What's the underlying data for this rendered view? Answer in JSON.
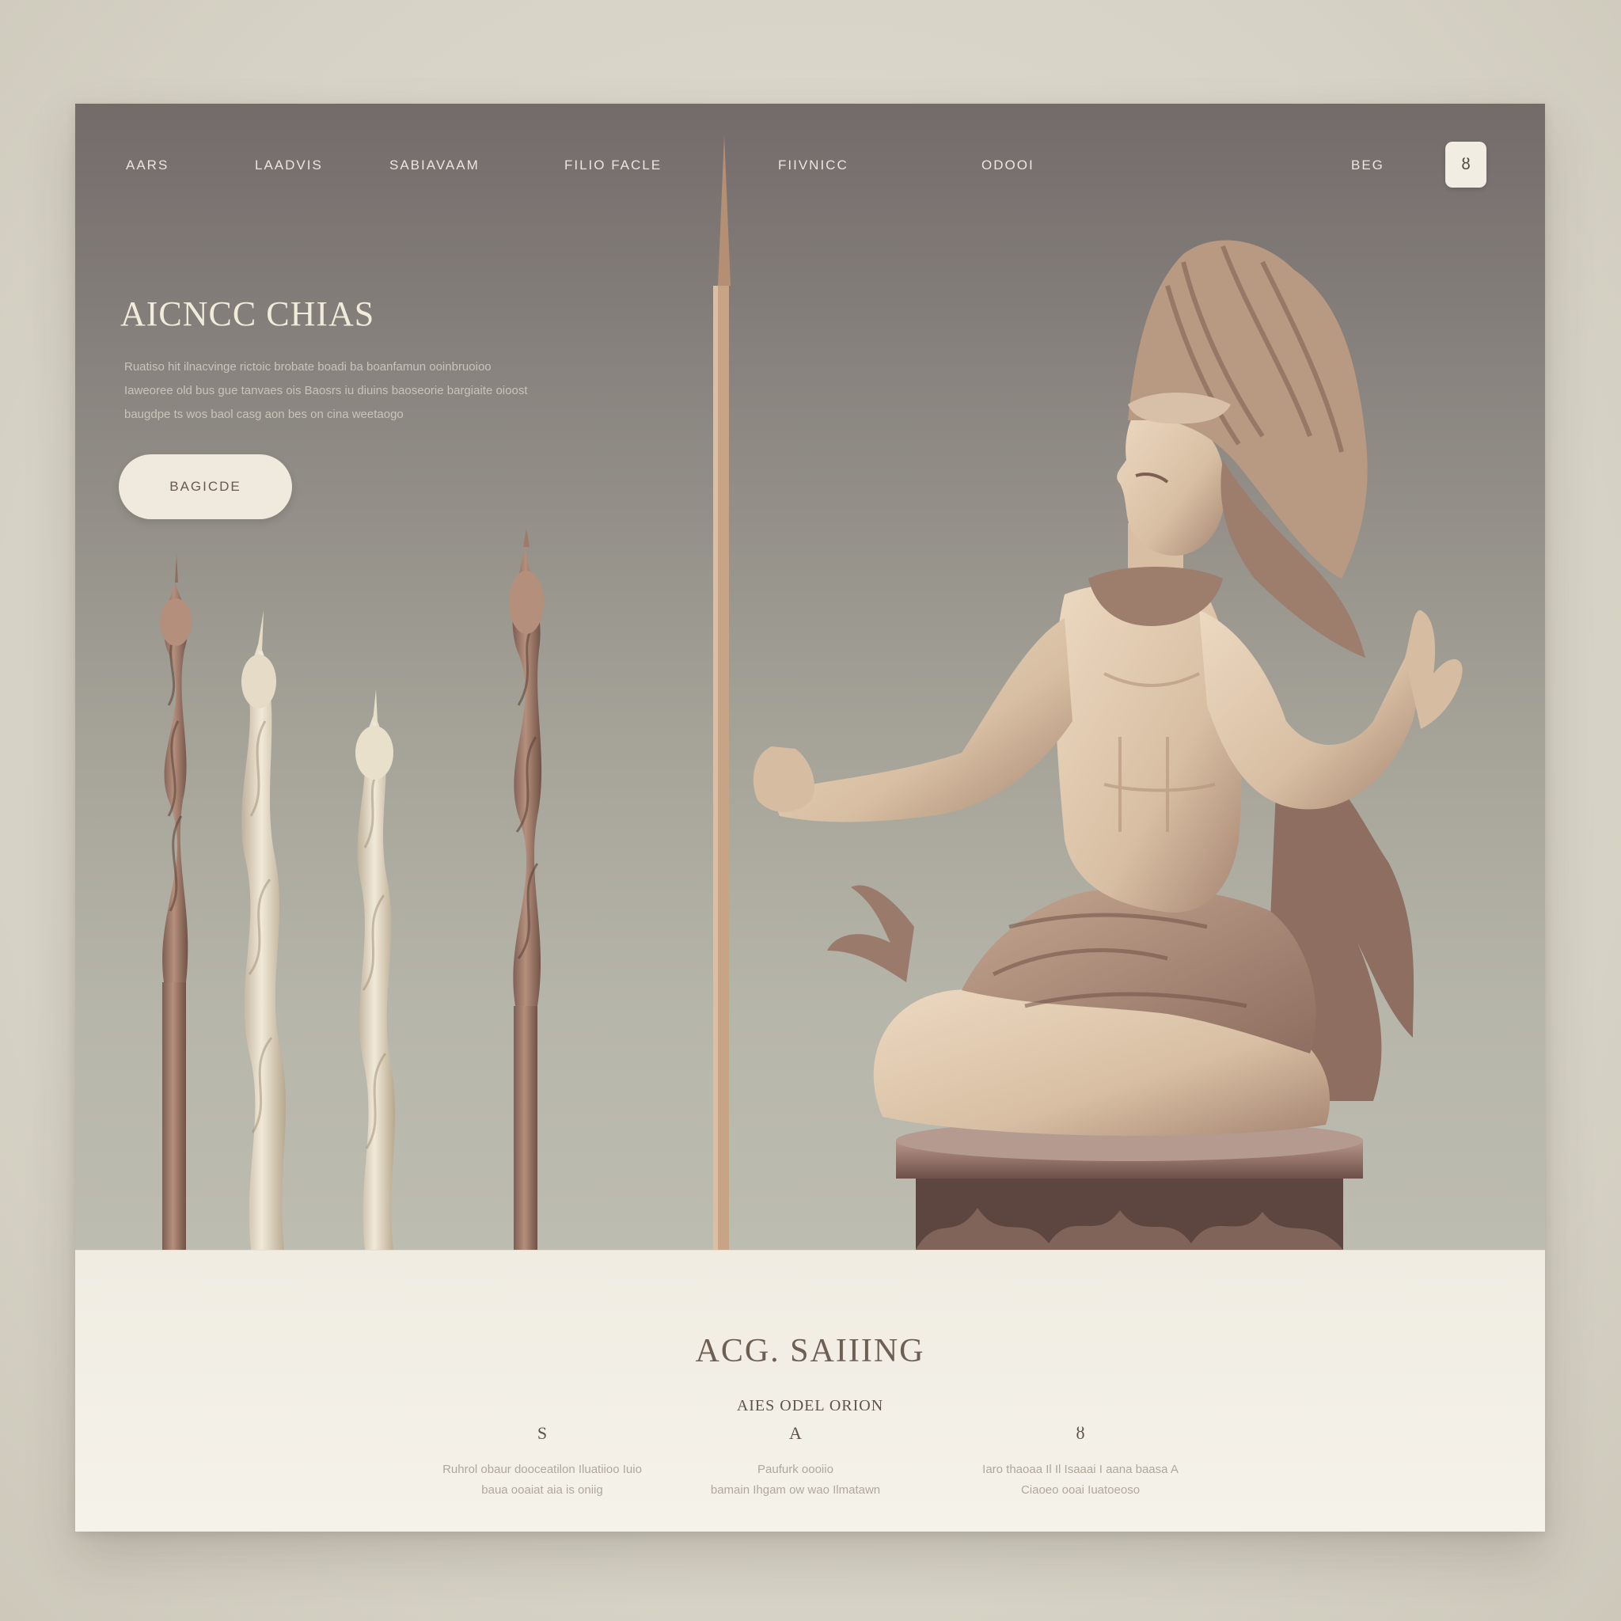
{
  "nav": {
    "items": [
      "AARS",
      "LAADVIS",
      "SABIAVAAM",
      "FILIO FACLE",
      "FIIVNICC",
      "ODOOI",
      "BEG"
    ],
    "action_icon": "user-icon",
    "action_glyph": "ȣ"
  },
  "hero": {
    "title": "AICNCC CHIAS",
    "description_lines": [
      "Ruatiso hit ilnacvinge rictoic brobate boadi ba boanfamun ooinbruoioo",
      "Iaweoree old bus gue tanvaes ois Baosrs iu diuins baoseorie bargiaite oioost",
      "baugdpe ts wos baol casg aon bes on cina weetaogo"
    ],
    "cta_label": "BAGICDE"
  },
  "section": {
    "title": "ACG. SAIIING",
    "subtitle": "AIES ODEL ORION",
    "features": [
      {
        "icon": "S",
        "lines": [
          "Ruhrol obaur dooceatilon Iluatiioo Iuio",
          "baua ooaiat aia is oniig"
        ]
      },
      {
        "icon": "A",
        "lines": [
          "Paufurk oooiio",
          "bamain Ihgam ow wao Ilmatawn"
        ]
      },
      {
        "icon": "ȣ",
        "lines": [
          "Iaro thaoaa Il Il Isaaai I aana baasa A",
          "Ciaoeo ooai Iuatoeoso"
        ]
      }
    ]
  },
  "colors": {
    "hero_top": "#736b6a",
    "hero_bottom": "#bdbcb0",
    "cream": "#f0ece2",
    "statue": "#d9c0a5",
    "staff_dark": "#a07c6a",
    "staff_light": "#e6dcc8"
  }
}
